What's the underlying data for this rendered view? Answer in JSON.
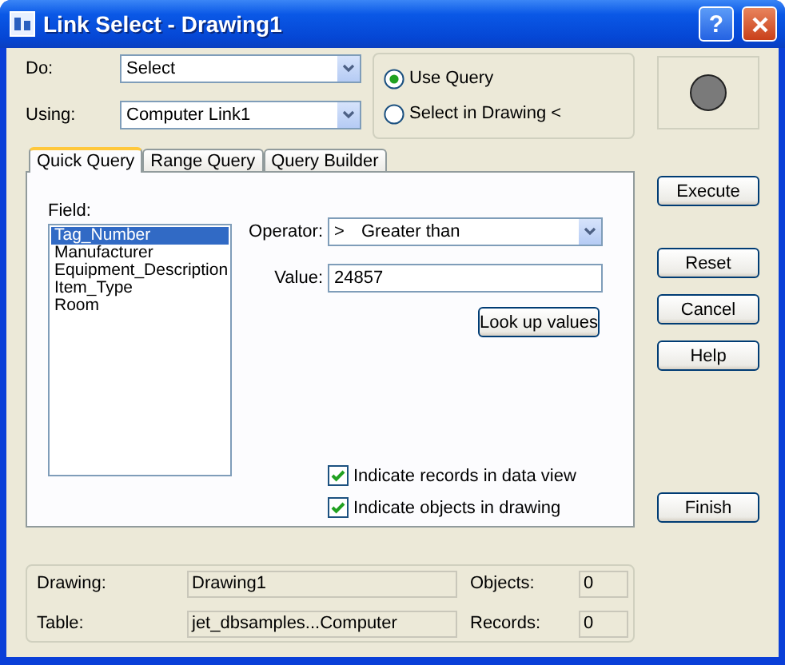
{
  "window": {
    "title": "Link Select - Drawing1",
    "help_glyph": "?"
  },
  "do": {
    "label": "Do:",
    "value": "Select"
  },
  "using": {
    "label": "Using:",
    "value": "Computer Link1"
  },
  "mode_options": [
    {
      "label": "Use Query",
      "selected": true
    },
    {
      "label": "Select in Drawing <",
      "selected": false
    }
  ],
  "tabs": [
    {
      "label": "Quick Query",
      "selected": true
    },
    {
      "label": "Range Query",
      "selected": false
    },
    {
      "label": "Query Builder",
      "selected": false
    }
  ],
  "quick_query": {
    "field_label": "Field:",
    "fields": [
      {
        "label": "Tag_Number",
        "selected": true
      },
      {
        "label": "Manufacturer",
        "selected": false
      },
      {
        "label": "Equipment_Description",
        "selected": false
      },
      {
        "label": "Item_Type",
        "selected": false
      },
      {
        "label": "Room",
        "selected": false
      }
    ],
    "operator": {
      "label": "Operator:",
      "symbol": ">",
      "value": "Greater than"
    },
    "value": {
      "label": "Value:",
      "value": "24857"
    },
    "lookup_button": "Look up values",
    "options": [
      {
        "label": "Indicate records in data view",
        "checked": true
      },
      {
        "label": "Indicate objects in drawing",
        "checked": true
      }
    ]
  },
  "execute_button": "Execute",
  "side_buttons": [
    "Reset",
    "Cancel",
    "Help"
  ],
  "finish_button": "Finish",
  "info": [
    {
      "label": "Drawing:",
      "value": "Drawing1",
      "count_label": "Objects:",
      "count": "0"
    },
    {
      "label": "Table:",
      "value": "jet_dbsamples...Computer",
      "count_label": "Records:",
      "count": "0"
    }
  ]
}
